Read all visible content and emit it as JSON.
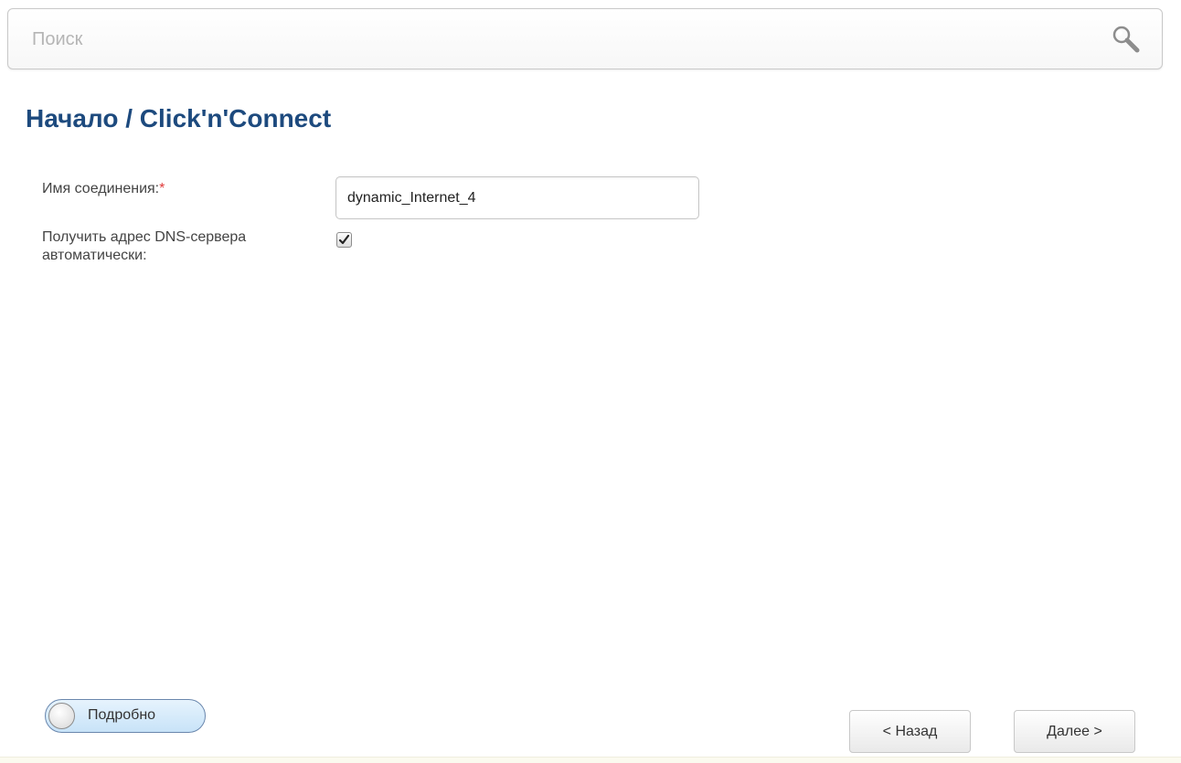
{
  "search": {
    "placeholder": "Поиск"
  },
  "breadcrumb": {
    "home": "Начало",
    "separator": " / ",
    "current": "Click'n'Connect"
  },
  "form": {
    "connection_name": {
      "label": "Имя соединения:",
      "required_mark": "*",
      "value": "dynamic_Internet_4"
    },
    "dns_auto": {
      "label": "Получить адрес DNS-сервера автоматически:",
      "checked": true
    }
  },
  "toggle": {
    "label": "Подробно",
    "on": false
  },
  "buttons": {
    "back_label": "< Назад",
    "next_label": "Далее >"
  },
  "colors": {
    "title": "#1d4a7e",
    "required": "#e03a3a",
    "toggle_bg": "#c8e3f8"
  },
  "icons": {
    "search": "magnifier-icon",
    "checkbox": "checkmark-icon"
  }
}
